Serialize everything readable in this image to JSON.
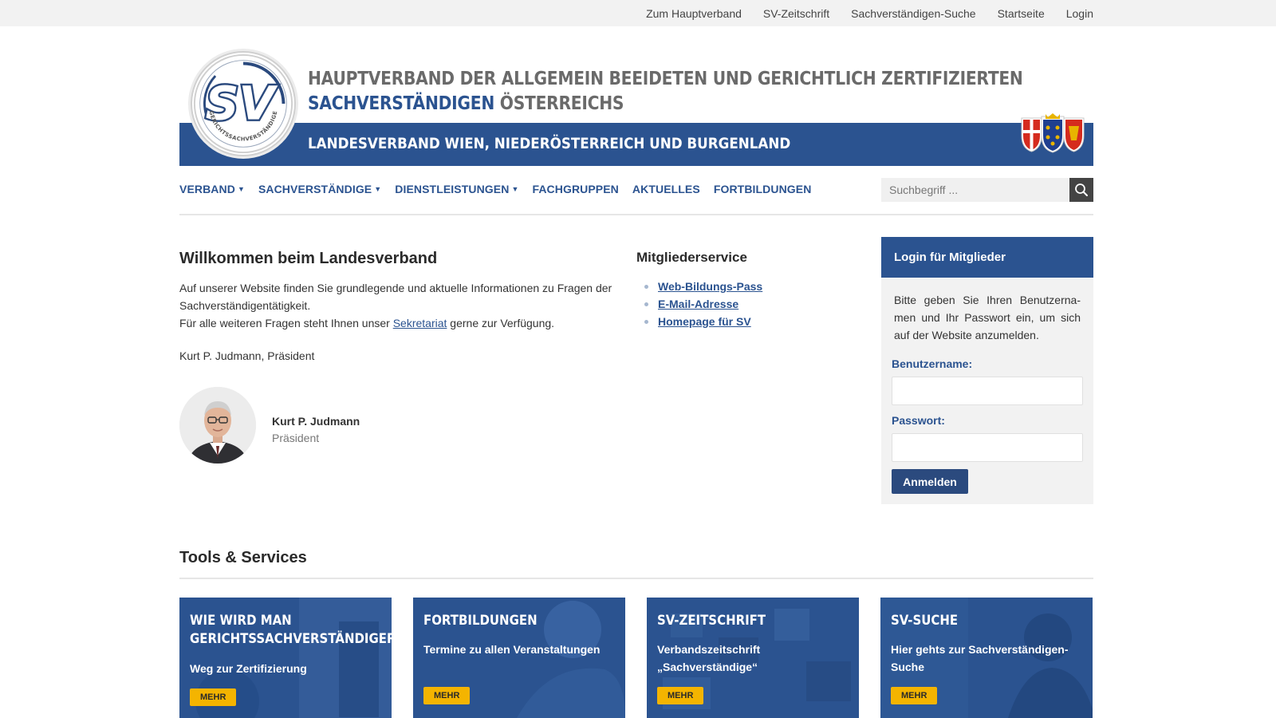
{
  "topbar": {
    "links": [
      "Zum Hauptverband",
      "SV-Zeitschrift",
      "Sachverständigen-Suche",
      "Startseite",
      "Login"
    ]
  },
  "header": {
    "title_line1": "HAUPTVERBAND DER ALLGEMEIN BEEIDETEN UND GERICHTLICH ZERTIFIZIERTEN",
    "title_line2_accent": "SACHVERSTÄNDIGEN",
    "title_line2_rest": " ÖSTERREICHS",
    "band_text": "LANDESVERBAND WIEN, NIEDERÖSTERREICH UND BURGENLAND",
    "logo_letters": "SV",
    "logo_ring_text": "GERICHTSSACHVERSTÄNDIGE"
  },
  "nav": {
    "items": [
      {
        "label": "VERBAND",
        "caret": "▼"
      },
      {
        "label": "SACHVERSTÄNDIGE",
        "caret": "▼"
      },
      {
        "label": "DIENSTLEISTUNGEN",
        "caret": "▼"
      },
      {
        "label": "FACHGRUPPEN",
        "caret": ""
      },
      {
        "label": "AKTUELLES",
        "caret": ""
      },
      {
        "label": "FORTBILDUNGEN",
        "caret": ""
      }
    ],
    "search_placeholder": "Suchbegriff ...",
    "search_icon": "search-icon"
  },
  "welcome": {
    "title": "Willkommen beim Landesverband",
    "text_1": "Auf unserer Website finden Sie grundlegende und aktuelle Informationen zu Fragen der Sachverständigentätigkeit.",
    "text_2_before": "Für alle weiteren Fragen steht Ihnen unser ",
    "text_2_link": "Sekretariat",
    "text_2_after": " gerne zur Verfügung.",
    "signature": "Kurt P. Judmann, Präsident",
    "person_name": "Kurt P. Judmann",
    "person_role": "Präsident"
  },
  "member_service": {
    "title": "Mitgliederservice",
    "links": [
      "Web-Bildungs-Pass",
      "E-Mail-Adresse",
      "Homepage für SV"
    ]
  },
  "login": {
    "title": "Login für Mitglieder",
    "intro": "Bitte geben Sie Ihren Benutzerna-men und Ihr Passwort ein, um sich auf der Website anzumelden.",
    "username_label": "Benutzername:",
    "password_label": "Passwort:",
    "username_value": "",
    "password_value": "",
    "submit_label": "Anmelden"
  },
  "tools": {
    "title": "Tools & Services",
    "cards": [
      {
        "title": "WIE WIRD MAN GERICHTSSACHVERSTÄNDIGER?",
        "subtitle": "Weg zur Zertifizierung",
        "more": "MEHR"
      },
      {
        "title": "FORTBILDUNGEN",
        "subtitle": "Termine zu allen Veranstaltungen",
        "more": "MEHR"
      },
      {
        "title": "SV-ZEITSCHRIFT",
        "subtitle": "Verbandszeitschrift „Sachverständige“",
        "more": "MEHR"
      },
      {
        "title": "SV-SUCHE",
        "subtitle": "Hier gehts zur Sachverständigen-Suche",
        "more": "MEHR"
      }
    ]
  },
  "colors": {
    "brand_blue": "#2b5390",
    "button_blue": "#2b4a7e",
    "accent_yellow": "#f4b400",
    "topbar_bg": "#f2f2f2"
  }
}
